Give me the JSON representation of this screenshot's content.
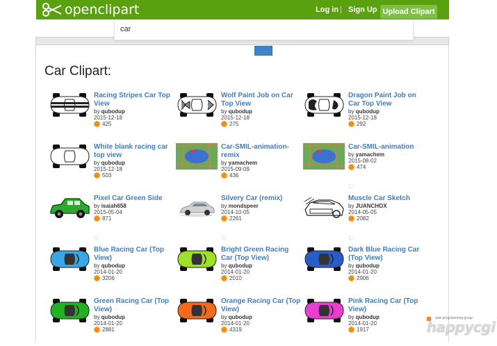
{
  "header": {
    "logo_text": "openclipart",
    "login": "Log in",
    "separator": "|",
    "signup": "Sign Up",
    "upload": "Upload Clipart"
  },
  "search": {
    "value": "car"
  },
  "page_title": "Car Clipart:",
  "colors": {
    "brand_green": "#59a10f",
    "link_blue": "#3b7fc4",
    "upload_green": "#7cc143",
    "download_orange": "#f08a1a"
  },
  "cards": [
    {
      "title": "Racing Stripes Car Top View",
      "by": "qubodup",
      "date": "2015-12-18",
      "downloads": "425",
      "thumb": "stripes-car"
    },
    {
      "title": "Wolf Paint Job on Car Top View",
      "by": "qubodup",
      "date": "2015-12-18",
      "downloads": "275",
      "thumb": "wolf-car"
    },
    {
      "title": "Dragon Paint Job on Car Top View",
      "by": "qubodup",
      "date": "2015-12-18",
      "downloads": "292",
      "thumb": "dragon-car"
    },
    {
      "title": "White blank racing car top view",
      "by": "qubodup",
      "date": "2015-12-18",
      "downloads": "503",
      "thumb": "white-car"
    },
    {
      "title": "Car-SMIL-animation-remix",
      "by": "yamachem",
      "date": "2015-09-09",
      "downloads": "436",
      "thumb": "map"
    },
    {
      "title": "Car-SMIL-animation",
      "by": "yamachem",
      "date": "2015-08-02",
      "downloads": "474",
      "thumb": "map"
    },
    {
      "title": "Pixel Car Green Side",
      "by": "isaiah658",
      "date": "2015-05-04",
      "downloads": "871",
      "thumb": "pixel-car"
    },
    {
      "title": "Silvery Car (remix)",
      "by": "mondspeer",
      "date": "2014-10-05",
      "downloads": "2261",
      "thumb": "silver-car"
    },
    {
      "title": "Muscle Car Sketch",
      "by": "JUANCHOX",
      "date": "2014-05-05",
      "downloads": "2082",
      "thumb": "muscle-car"
    },
    {
      "title": "Blue Racing Car (Top View)",
      "by": "qubodup",
      "date": "2014-01-20",
      "downloads": "3206",
      "thumb": "racing-blue"
    },
    {
      "title": "Bright Green Racing Car (Top View)",
      "by": "qubodup",
      "date": "2014-01-20",
      "downloads": "2010",
      "thumb": "racing-lime"
    },
    {
      "title": "Dark Blue Racing Car (Top View)",
      "by": "qubodup",
      "date": "2014-01-20",
      "downloads": "2906",
      "thumb": "racing-darkblue"
    },
    {
      "title": "Green Racing Car (Top View)",
      "by": "qubodup",
      "date": "2014-01-20",
      "downloads": "2881",
      "thumb": "racing-green"
    },
    {
      "title": "Orange Racing Car (Top View)",
      "by": "qubodup",
      "date": "2014-01-20",
      "downloads": "4319",
      "thumb": "racing-orange"
    },
    {
      "title": "Pink Racing Car (Top View)",
      "by": "qubodup",
      "date": "2014-01-20",
      "downloads": "1917",
      "thumb": "racing-pink"
    }
  ],
  "watermark": {
    "small": "web programming group",
    "big": "happycgi"
  }
}
